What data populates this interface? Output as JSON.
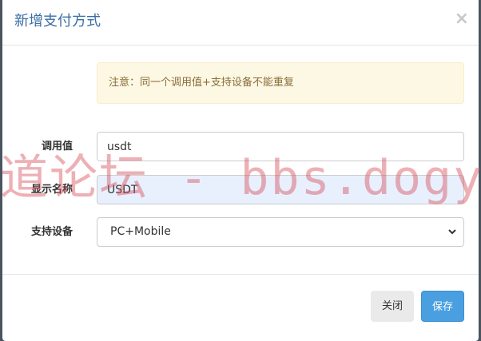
{
  "modal": {
    "title": "新增支付方式",
    "close_glyph": "×",
    "notice": "注意：同一个调用值+支持设备不能重复",
    "fields": {
      "call_value": {
        "label": "调用值",
        "value": "usdt"
      },
      "display_name": {
        "label": "显示名称",
        "value": "USDT"
      },
      "device": {
        "label": "支持设备",
        "selected": "PC+Mobile"
      }
    },
    "buttons": {
      "close": "关闭",
      "save": "保存"
    }
  },
  "watermark": "道论坛 - bbs.dogyx.c"
}
